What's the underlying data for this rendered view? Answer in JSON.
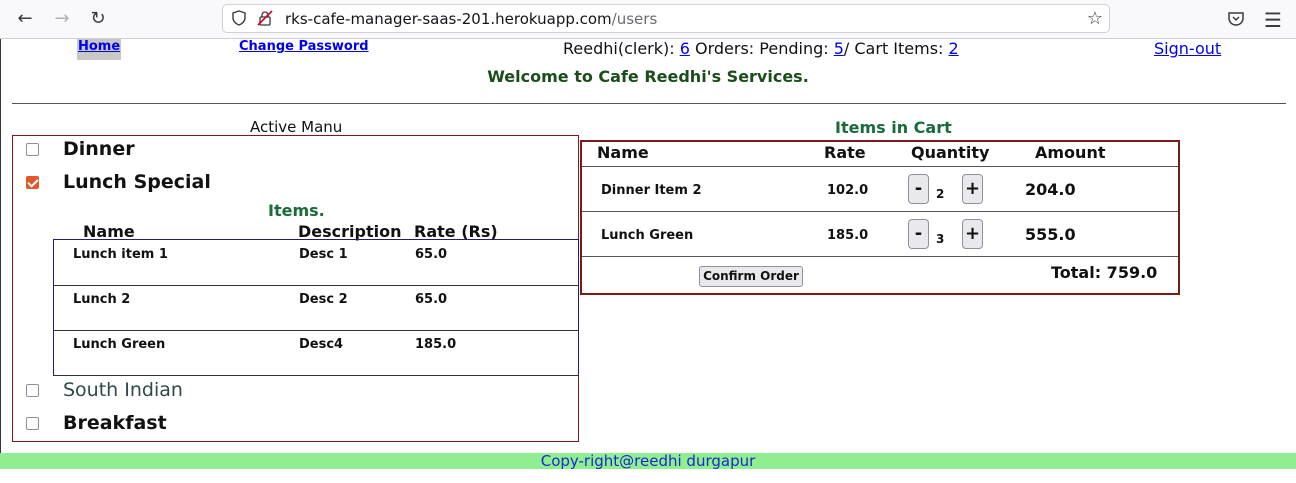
{
  "browser": {
    "back_icon": "arrow-left-icon",
    "forward_icon": "arrow-right-icon",
    "reload_icon": "reload-icon",
    "url_domain": "rks-cafe-manager-saas-201.herokuapp.com",
    "url_path": "/users",
    "bookmark_icon": "star-icon",
    "pocket_icon": "pocket-icon",
    "menu_icon": "hamburger-menu-icon"
  },
  "nav": {
    "home": "Home",
    "change_password": "Change Password",
    "user_label": "Reedhi(clerk): ",
    "user_count": "6",
    "orders_label": " Orders: Pending: ",
    "pending_count": "5",
    "cart_label": "/ Cart Items: ",
    "cart_count": "2",
    "sign_out": "Sign-out"
  },
  "welcome": "Welcome to Cafe Reedhi's Services.",
  "menu": {
    "title": "Active Manu",
    "categories": [
      {
        "label": "Dinner",
        "checked": false
      },
      {
        "label": "Lunch Special",
        "checked": true
      },
      {
        "label": "South Indian",
        "checked": false
      },
      {
        "label": "Breakfast",
        "checked": false
      }
    ],
    "items_heading": "Items.",
    "columns": [
      "Name",
      "Description",
      "Rate (Rs)"
    ],
    "items": [
      {
        "name": "Lunch item 1",
        "description": "Desc 1",
        "rate": "65.0"
      },
      {
        "name": "Lunch 2",
        "description": "Desc 2",
        "rate": "65.0"
      },
      {
        "name": "Lunch Green",
        "description": "Desc4",
        "rate": "185.0"
      }
    ]
  },
  "cart": {
    "title": "Items in Cart",
    "columns": [
      "Name",
      "Rate",
      "Quantity",
      "Amount"
    ],
    "rows": [
      {
        "name": "Dinner Item 2",
        "rate": "102.0",
        "minus": "-",
        "qty": "2",
        "plus": "+",
        "amount": "204.0"
      },
      {
        "name": "Lunch Green",
        "rate": "185.0",
        "minus": "-",
        "qty": "3",
        "plus": "+",
        "amount": "555.0"
      }
    ],
    "confirm_label": "Confirm Order",
    "total": "Total: 759.0"
  },
  "footer": "Copy-right@reedhi durgapur",
  "colors": {
    "footer_bg": "#90ee90",
    "heading_green": "#1a6b3a",
    "box_border": "#7b1a1a",
    "link": "#0000ee",
    "checkbox_checked": "#e0592a"
  }
}
